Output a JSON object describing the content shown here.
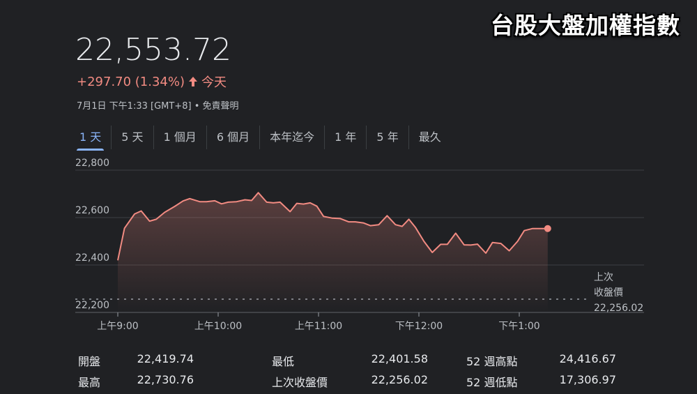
{
  "overlay_title": "台股大盤加權指數",
  "quote": {
    "price": "22,553.72",
    "change": "+297.70 (1.34%)",
    "period": "今天",
    "timestamp": "7月1日 下午1:33 [GMT+8]",
    "separator": "•",
    "disclaimer": "免責聲明"
  },
  "colors": {
    "positive": "#f28b82",
    "accent": "#8ab4f8",
    "background": "#202124"
  },
  "icons": {
    "change_direction": "arrow-up-icon"
  },
  "tabs": [
    {
      "label": "1 天",
      "active": true
    },
    {
      "label": "5 天"
    },
    {
      "label": "1 個月"
    },
    {
      "label": "6 個月"
    },
    {
      "label": "本年迄今"
    },
    {
      "label": "1 年"
    },
    {
      "label": "5 年"
    },
    {
      "label": "最久"
    }
  ],
  "chart_data": {
    "type": "area",
    "y_ticks": [
      "22,800",
      "22,600",
      "22,400",
      "22,200"
    ],
    "y_tick_values": [
      22800,
      22600,
      22400,
      22200
    ],
    "ylim": [
      22200,
      22800
    ],
    "x_ticks": [
      "上午9:00",
      "上午10:00",
      "上午11:00",
      "下午12:00",
      "下午1:00"
    ],
    "x_tick_minutes": [
      0,
      60,
      120,
      180,
      240
    ],
    "xlim_minutes": [
      0,
      270
    ],
    "grid": true,
    "previous_close": {
      "label_line1": "上次",
      "label_line2": "收盤價",
      "value_text": "22,256.02",
      "value": 22256.02
    },
    "series": [
      {
        "x_minutes": [
          0,
          4,
          10,
          14,
          19,
          23,
          28,
          34,
          39,
          43,
          49,
          53,
          58,
          62,
          66,
          71,
          76,
          80,
          84,
          89,
          93,
          97,
          103,
          107,
          111,
          115,
          119,
          123,
          128,
          133,
          138,
          142,
          147,
          151,
          156,
          161,
          166,
          170,
          174,
          178,
          183,
          188,
          193,
          197,
          202,
          207,
          211,
          215,
          220,
          224,
          229,
          234,
          239,
          243,
          248,
          253,
          257
        ],
        "values": [
          22419.74,
          22555,
          22615,
          22628,
          22585,
          22593,
          22622,
          22647,
          22670,
          22680,
          22667,
          22667,
          22671,
          22658,
          22665,
          22667,
          22675,
          22672,
          22705,
          22665,
          22662,
          22665,
          22625,
          22660,
          22657,
          22662,
          22648,
          22605,
          22598,
          22596,
          22582,
          22582,
          22577,
          22566,
          22570,
          22608,
          22570,
          22563,
          22593,
          22558,
          22500,
          22453,
          22487,
          22487,
          22534,
          22485,
          22484,
          22488,
          22450,
          22495,
          22491,
          22460,
          22500,
          22545,
          22553.72,
          22553.72,
          22553.72
        ]
      }
    ]
  },
  "stats": {
    "open_label": "開盤",
    "open_value": "22,419.74",
    "high_label": "最高",
    "high_value": "22,730.76",
    "low_label": "最低",
    "low_value": "22,401.58",
    "prev_close_label": "上次收盤價",
    "prev_close_value": "22,256.02",
    "high52_label": "52 週高點",
    "high52_value": "24,416.67",
    "low52_label": "52 週低點",
    "low52_value": "17,306.97"
  }
}
